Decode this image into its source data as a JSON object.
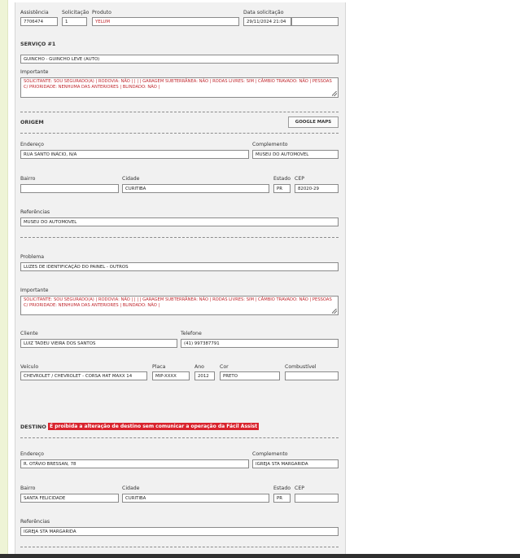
{
  "header": {
    "assistencia_label": "Assistência",
    "assistencia_value": "7706474",
    "solicitacao_label": "Solicitação",
    "solicitacao_value": "1",
    "produto_label": "Produto",
    "produto_value": "YELUM",
    "data_label": "Data solicitação",
    "data_value": "29/11/2024 21:04",
    "extra_value": ""
  },
  "servico": {
    "title": "SERVIÇO #1",
    "value": "GUINCHO - GUINCHO LEVE (AUTO)",
    "importante_label": "Importante",
    "importante_text": "SOLICITANTE: SOU SEGURADO(A) | RODOVIA: NÃO | | | | GARAGEM SUBTERRÂNEA: NÃO | RODAS LIVRES: SIM | CÂMBIO TRAVADO: NÃO | PESSOAS C/ PRIORIDADE: NENHUMA DAS ANTERIORES | BLINDADO: NÃO |"
  },
  "origem": {
    "title": "ORIGEM",
    "maps_button": "GOOGLE MAPS",
    "endereco_label": "Endereço",
    "endereco_value": "RUA SANTO INÁCIO, N/A",
    "complemento_label": "Complemento",
    "complemento_value": "MUSEU DO AUTOMOVEL",
    "bairro_label": "Bairro",
    "bairro_value": "",
    "cidade_label": "Cidade",
    "cidade_value": "CURITIBA",
    "estado_label": "Estado",
    "estado_value": "PR",
    "cep_label": "CEP",
    "cep_value": "82020-29",
    "referencias_label": "Referências",
    "referencias_value": "MUSEU DO AUTOMOVEL"
  },
  "problema": {
    "label": "Problema",
    "value": "LUZES DE IDENTIFICAÇÃO DO PAINEL - OUTROS",
    "importante_label": "Importante",
    "importante_text": "SOLICITANTE: SOU SEGURADO(A) | RODOVIA: NÃO | | | | GARAGEM SUBTERRÂNEA: NÃO | RODAS LIVRES: SIM | CÂMBIO TRAVADO: NÃO | PESSOAS C/ PRIORIDADE: NENHUMA DAS ANTERIORES | BLINDADO: NÃO |"
  },
  "cliente": {
    "cliente_label": "Cliente",
    "cliente_value": "LUIZ TADEU VIEIRA DOS SANTOS",
    "telefone_label": "Telefone",
    "telefone_value": "(41) 997387791"
  },
  "veiculo": {
    "veiculo_label": "Veículo",
    "veiculo_value": "CHEVROLET / CHEVROLET - CORSA HAT MAXX 14",
    "placa_label": "Placa",
    "placa_value": "MIP-XXXX",
    "ano_label": "Ano",
    "ano_value": "2012",
    "cor_label": "Cor",
    "cor_value": "PRETO",
    "combustivel_label": "Combustível",
    "combustivel_value": ""
  },
  "destino": {
    "title": "DESTINO",
    "warning": "É proibida a alteração de destino sem comunicar a operação da Fácil Assist",
    "endereco_label": "Endereço",
    "endereco_value": "R. OTÁVIO BRESSAN, 78",
    "complemento_label": "Complemento",
    "complemento_value": "IGREJA STA MARGARIDA",
    "bairro_label": "Bairro",
    "bairro_value": "SANTA FELICIDADE",
    "cidade_label": "Cidade",
    "cidade_value": "CURITIBA",
    "estado_label": "Estado",
    "estado_value": "PR",
    "cep_label": "CEP",
    "cep_value": "",
    "referencias_label": "Referências",
    "referencias_value": "IGREJA STA MARGARIDA"
  },
  "colors": {
    "panel": "#f1f1f1",
    "warning": "#d9232d",
    "red_text": "#c0262c"
  }
}
